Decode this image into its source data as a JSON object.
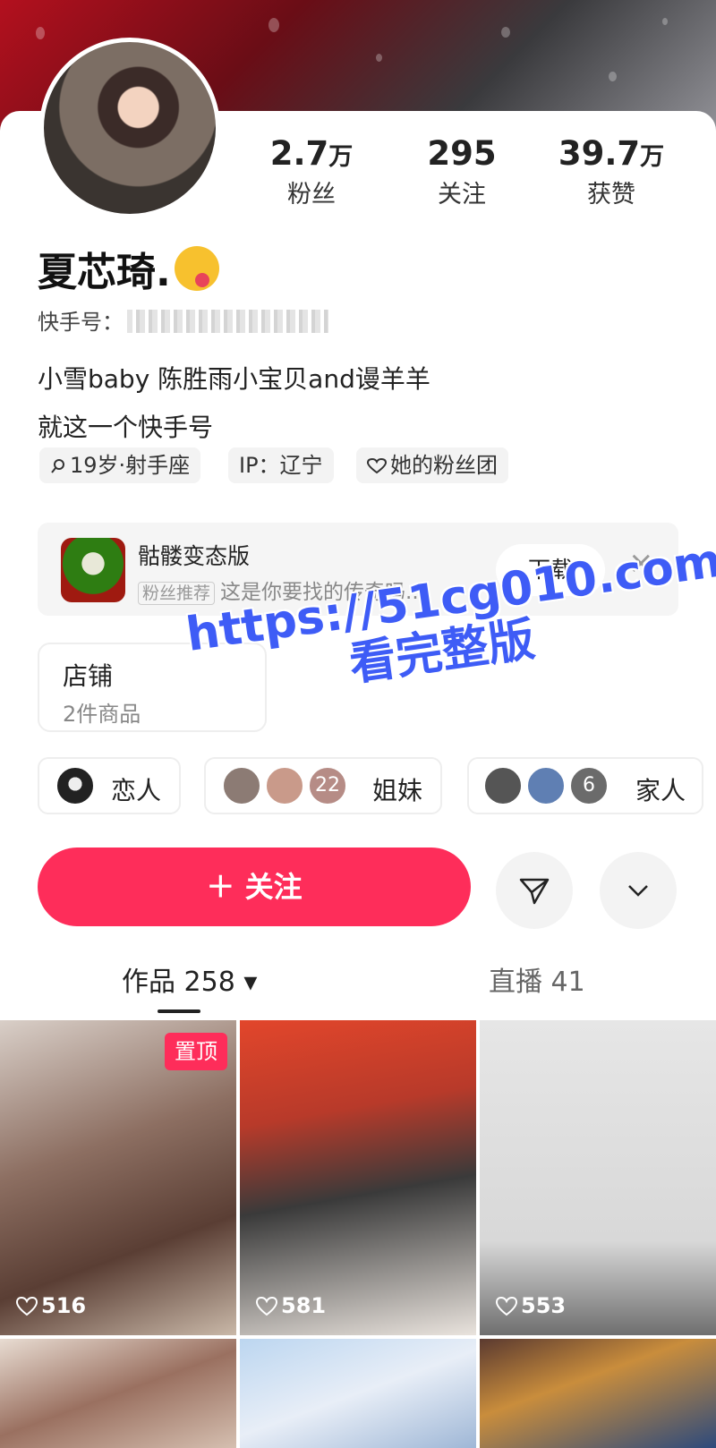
{
  "profile": {
    "name": "夏芯琦.",
    "kuaishou_label": "快手号：",
    "bio_line1": "小雪baby 陈胜雨小宝贝and谩羊羊",
    "bio_line2": "就这一个快手号",
    "tags": [
      "19岁·射手座",
      "IP：辽宁",
      "她的粉丝团"
    ]
  },
  "stats": [
    {
      "value": "2.7",
      "unit": "万",
      "label": "粉丝"
    },
    {
      "value": "295",
      "unit": "",
      "label": "关注"
    },
    {
      "value": "39.7",
      "unit": "万",
      "label": "获赞"
    }
  ],
  "ad": {
    "title": "骷髅变态版",
    "badge": "粉丝推荐",
    "desc": "这是你要找的传奇吗...",
    "button": "下载",
    "close": "×"
  },
  "shop": {
    "title": "店铺",
    "sub": "2件商品"
  },
  "watermark": {
    "line1": "https://51cg010.com",
    "line2": "看完整版"
  },
  "relations": [
    {
      "label": "恋人"
    },
    {
      "label": "姐妹",
      "count": "22"
    },
    {
      "label": "家人",
      "count": "6"
    }
  ],
  "actions": {
    "follow": "＋ 关注"
  },
  "tabs": [
    {
      "label": "作品 258 ▾"
    },
    {
      "label": "直播 41"
    }
  ],
  "posts": [
    {
      "likes": "516",
      "pinned": "置顶"
    },
    {
      "likes": "581"
    },
    {
      "likes": "553"
    }
  ],
  "colors": {
    "accent": "#fe2d5a",
    "watermark": "#3e5cf6"
  }
}
